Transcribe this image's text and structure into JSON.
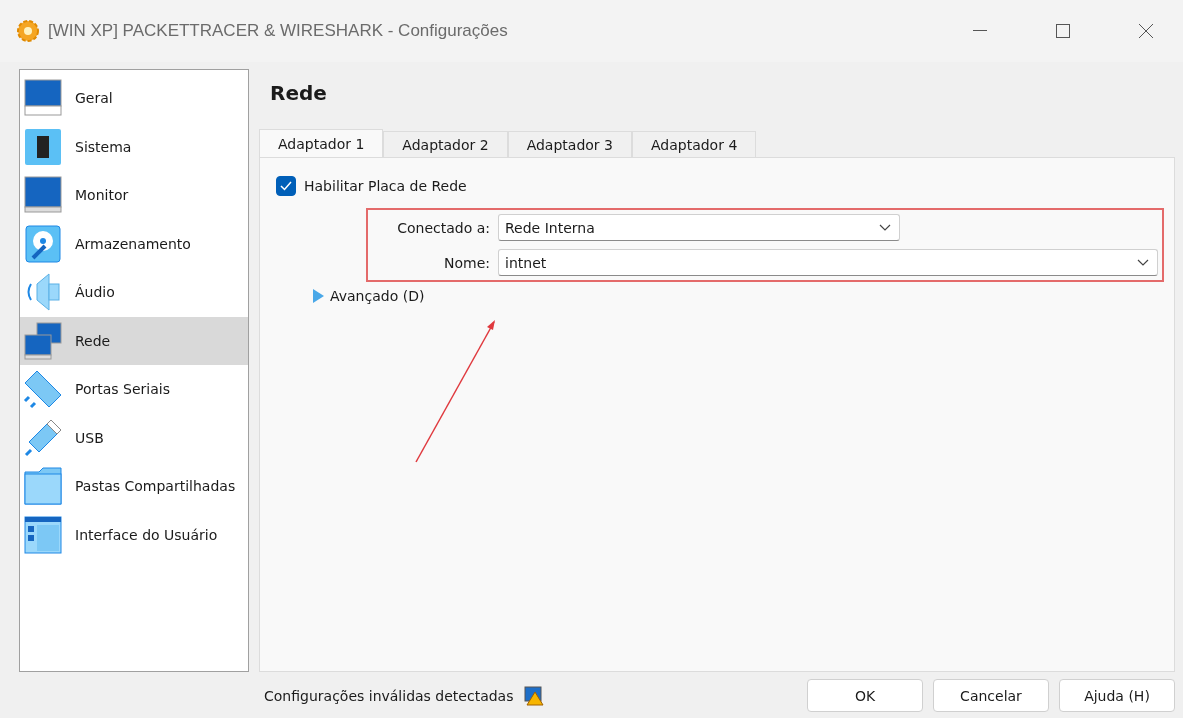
{
  "window": {
    "title": "[WIN XP] PACKETTRACER & WIRESHARK - Configurações"
  },
  "sidebar": {
    "items": [
      {
        "label": "Geral",
        "selected": false
      },
      {
        "label": "Sistema",
        "selected": false
      },
      {
        "label": "Monitor",
        "selected": false
      },
      {
        "label": "Armazenamento",
        "selected": false
      },
      {
        "label": "Áudio",
        "selected": false
      },
      {
        "label": "Rede",
        "selected": true
      },
      {
        "label": "Portas Seriais",
        "selected": false
      },
      {
        "label": "USB",
        "selected": false
      },
      {
        "label": "Pastas Compartilhadas",
        "selected": false
      },
      {
        "label": "Interface do Usuário",
        "selected": false
      }
    ]
  },
  "page": {
    "heading": "Rede",
    "tabs": [
      {
        "label": "Adaptador 1",
        "selected": true
      },
      {
        "label": "Adaptador 2",
        "selected": false
      },
      {
        "label": "Adaptador 3",
        "selected": false
      },
      {
        "label": "Adaptador 4",
        "selected": false
      }
    ],
    "enable_checkbox": {
      "label": "Habilitar Placa de Rede",
      "checked": true
    },
    "fields": [
      {
        "label": "Conectado a:",
        "value": "Rede Interna",
        "wide": false
      },
      {
        "label": "Nome:",
        "value": "intnet",
        "wide": true
      }
    ],
    "advanced": {
      "label": "Avançado (D)",
      "expanded": false
    }
  },
  "status": {
    "message": "Configurações inválidas detectadas"
  },
  "buttons": [
    "OK",
    "Cancelar",
    "Ajuda (H)"
  ]
}
